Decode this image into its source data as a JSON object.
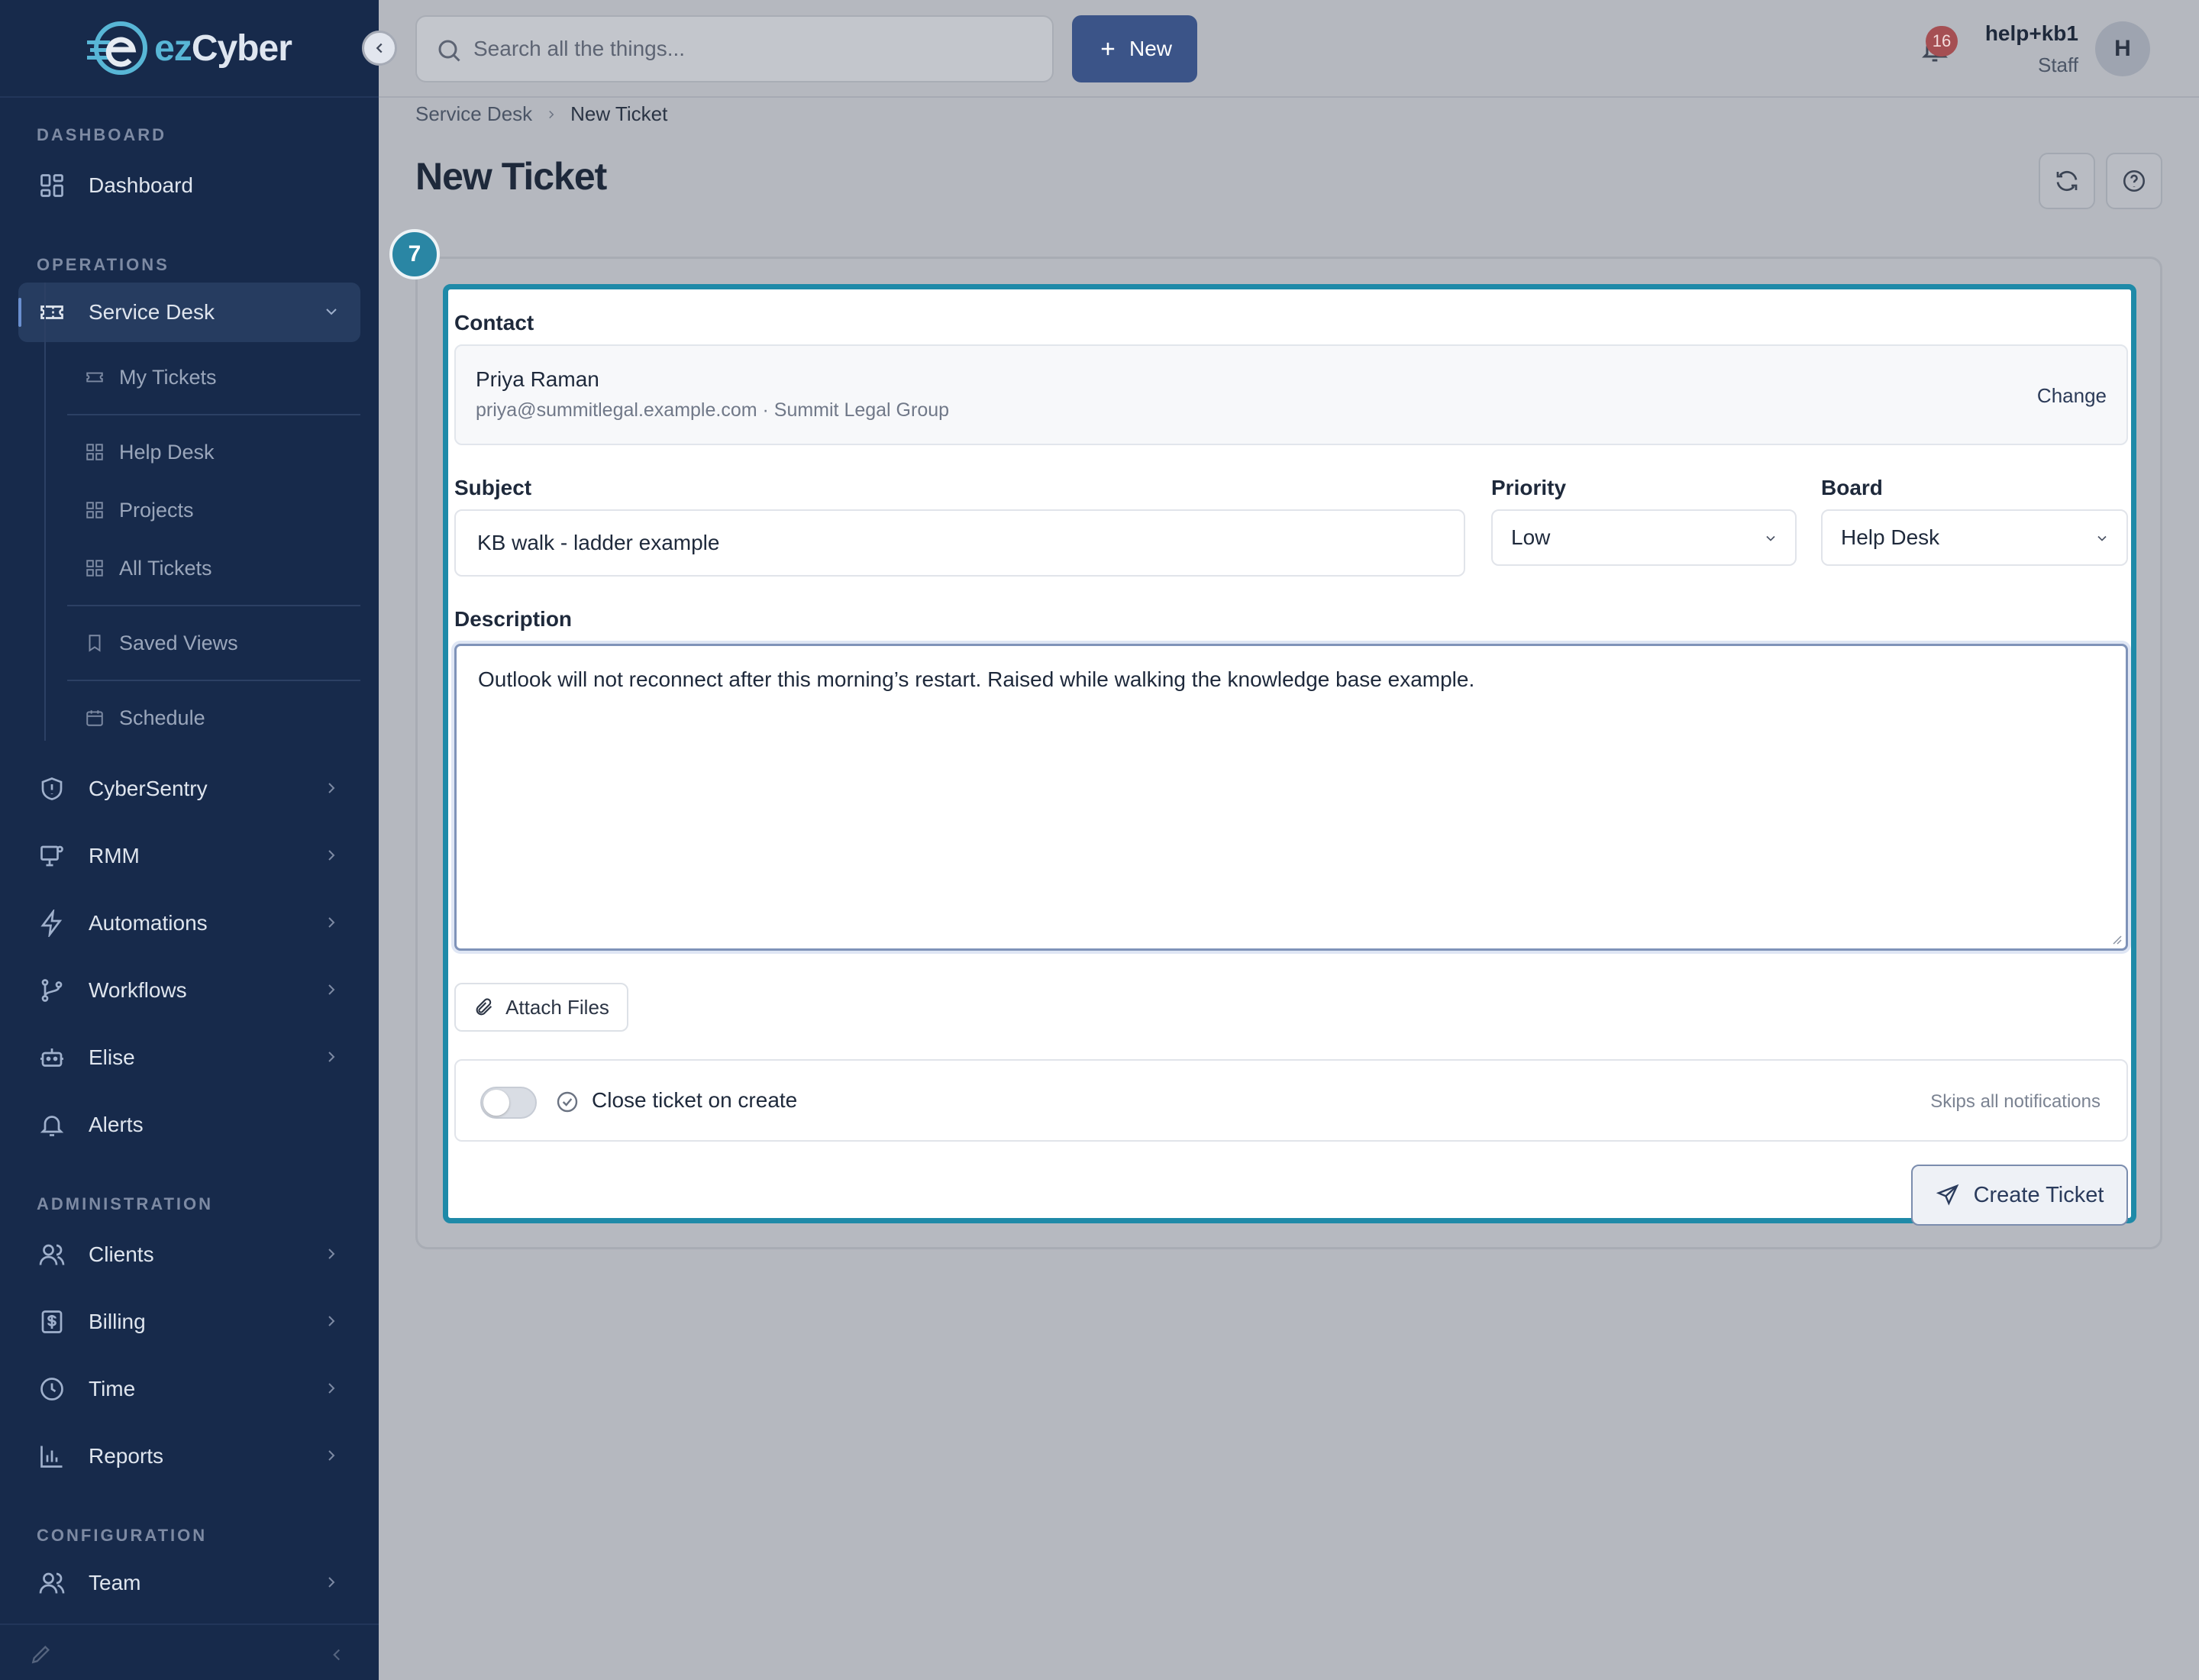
{
  "brand": {
    "name_prefix": "ez",
    "name_suffix": "Cyber"
  },
  "sidebar": {
    "sections": {
      "dashboard": "DASHBOARD",
      "operations": "OPERATIONS",
      "administration": "ADMINISTRATION",
      "configuration": "CONFIGURATION"
    },
    "items": {
      "dashboard": "Dashboard",
      "service_desk": "Service Desk",
      "cybersentry": "CyberSentry",
      "rmm": "RMM",
      "automations": "Automations",
      "workflows": "Workflows",
      "elise": "Elise",
      "alerts": "Alerts",
      "clients": "Clients",
      "billing": "Billing",
      "time": "Time",
      "reports": "Reports",
      "team": "Team"
    },
    "sub_items": {
      "my_tickets": "My Tickets",
      "help_desk": "Help Desk",
      "projects": "Projects",
      "all_tickets": "All Tickets",
      "saved_views": "Saved Views",
      "schedule": "Schedule"
    }
  },
  "topbar": {
    "search_placeholder": "Search all the things...",
    "new_label": "New",
    "notification_count": "16",
    "user_name": "help+kb1",
    "user_role": "Staff",
    "avatar_initial": "H"
  },
  "breadcrumb": {
    "parent": "Service Desk",
    "current": "New Ticket"
  },
  "page": {
    "title": "New Ticket",
    "step_number": "7"
  },
  "form": {
    "contact_label": "Contact",
    "contact_name": "Priya Raman",
    "contact_email_org": "priya@summitlegal.example.com · Summit Legal Group",
    "change_label": "Change",
    "subject_label": "Subject",
    "subject_value": "KB walk - ladder example",
    "priority_label": "Priority",
    "priority_value": "Low",
    "board_label": "Board",
    "board_value": "Help Desk",
    "description_label": "Description",
    "description_value": "Outlook will not reconnect after this morning’s restart. Raised while walking the knowledge base example.",
    "attach_label": "Attach Files",
    "close_toggle_label": "Close ticket on create",
    "close_toggle_hint": "Skips all notifications",
    "close_toggle_on": false,
    "submit_label": "Create Ticket"
  },
  "colors": {
    "sidebar_bg": "#172a4b",
    "accent_teal": "#1f8aa8",
    "primary_button": "#3b5488",
    "badge_red": "#a54f53"
  }
}
